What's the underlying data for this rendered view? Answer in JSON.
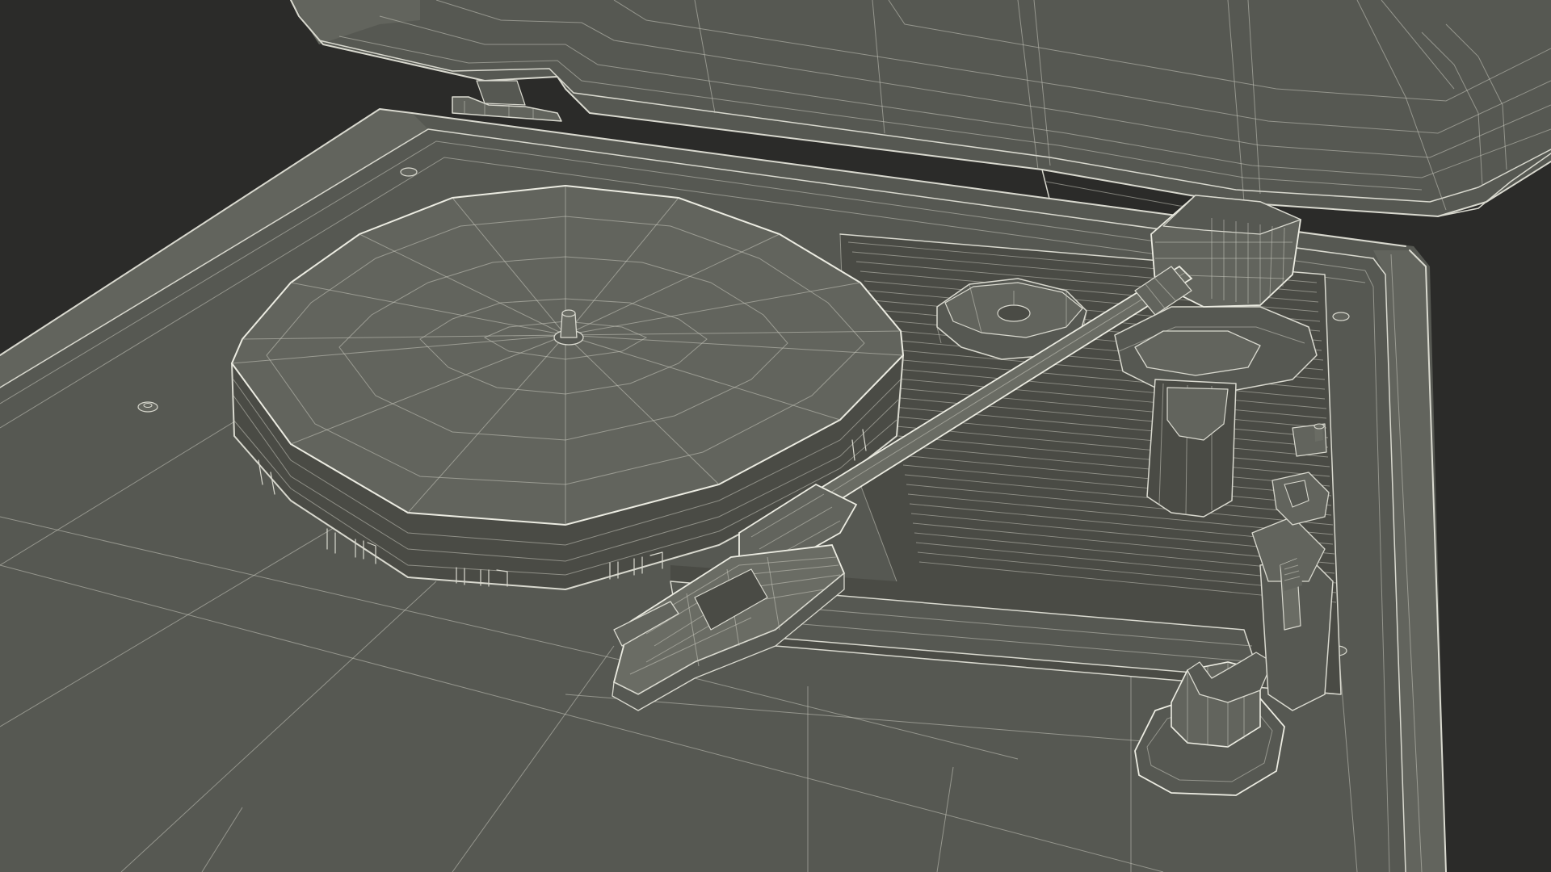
{
  "scene": {
    "subject": "turntable-wireframe-render",
    "colors": {
      "background": "#2b2b29",
      "surface": "#565852",
      "surface_light": "#62645d",
      "surface_dark": "#4a4b45",
      "wire": "#d9d9cf"
    },
    "parts": {
      "lid": "lid",
      "base": "base",
      "platter": "platter",
      "spindle": "spindle",
      "tonearm": "tonearm",
      "headshell": "headshell",
      "counterweight": "counterweight",
      "pivot": "pivot",
      "arm_rest": "arm-rest",
      "lever": "lever",
      "adapter": "adapter",
      "deck_panel": "deck-panel"
    }
  }
}
